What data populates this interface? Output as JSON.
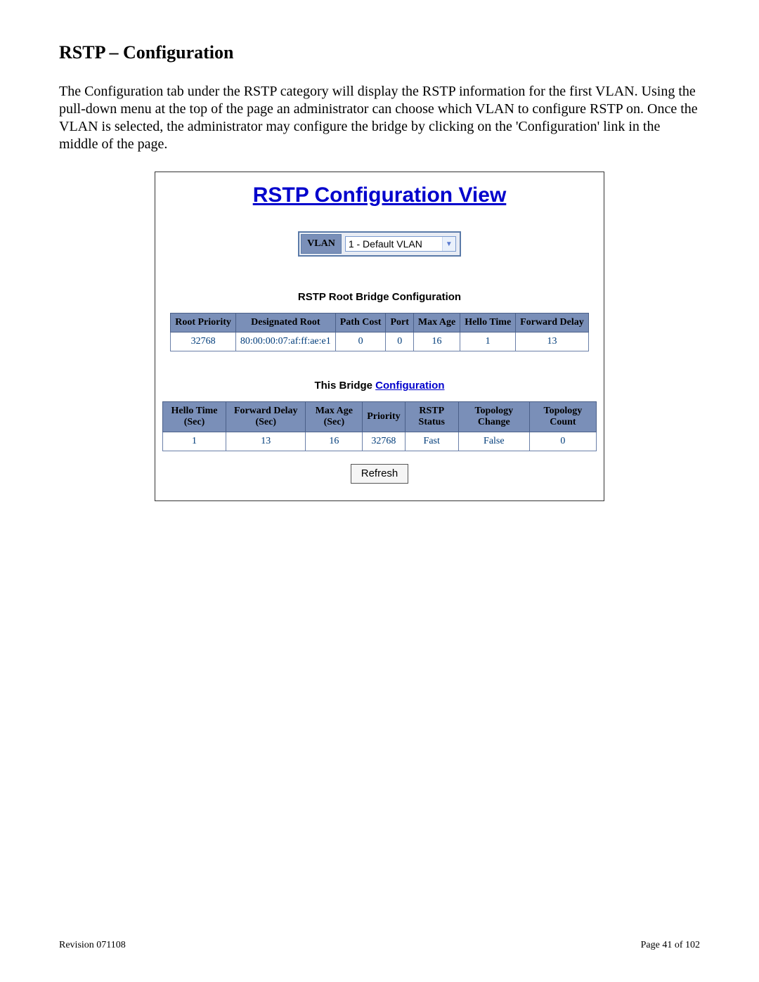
{
  "heading": "RSTP – Configuration",
  "bodytext": "The Configuration tab under the RSTP category will display the RSTP information for the first VLAN. Using the pull-down menu at the top of the page an administrator can choose which VLAN to configure RSTP on.  Once the VLAN is selected, the administrator may configure the bridge by clicking on the 'Configuration' link in the middle of the page.",
  "panel": {
    "title": "RSTP Configuration View",
    "vlan_label": "VLAN",
    "vlan_selected": "1 - Default VLAN",
    "root_section_title": "RSTP Root Bridge Configuration",
    "root_headers": [
      "Root Priority",
      "Designated Root",
      "Path Cost",
      "Port",
      "Max Age",
      "Hello Time",
      "Forward Delay"
    ],
    "root_values": [
      "32768",
      "80:00:00:07:af:ff:ae:e1",
      "0",
      "0",
      "16",
      "1",
      "13"
    ],
    "bridge_section_prefix": "This Bridge ",
    "bridge_section_link": "Configuration",
    "bridge_headers": [
      "Hello Time (Sec)",
      "Forward Delay (Sec)",
      "Max Age (Sec)",
      "Priority",
      "RSTP Status",
      "Topology Change",
      "Topology Count"
    ],
    "bridge_values": [
      "1",
      "13",
      "16",
      "32768",
      "Fast",
      "False",
      "0"
    ],
    "refresh_label": "Refresh"
  },
  "footer": {
    "revision": "Revision 071108",
    "page": "Page 41 of 102"
  }
}
